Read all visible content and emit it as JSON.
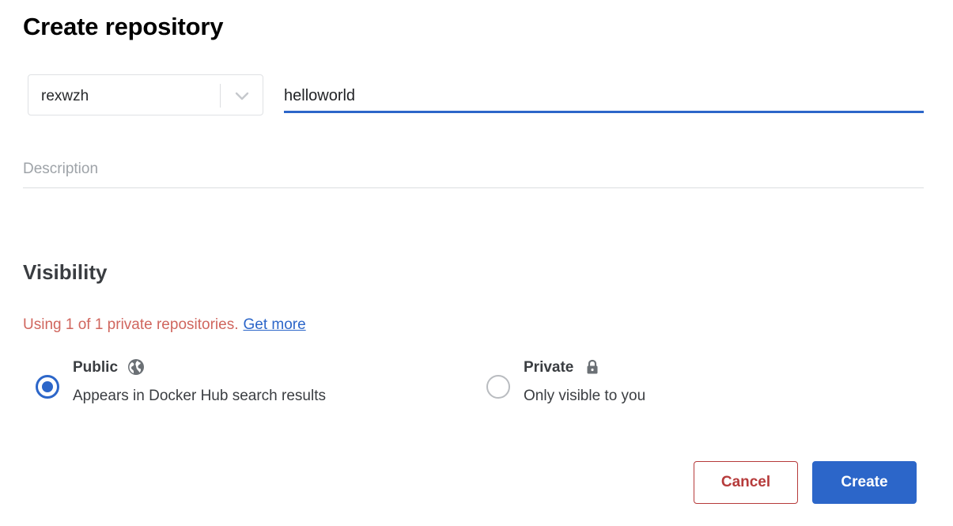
{
  "page": {
    "title": "Create repository"
  },
  "form": {
    "namespace": {
      "selected": "rexwzh",
      "icon": "chevron-down-icon"
    },
    "repo_name": {
      "value": "helloworld"
    },
    "description": {
      "placeholder": "Description",
      "value": ""
    }
  },
  "visibility": {
    "heading": "Visibility",
    "usage_text": "Using 1 of 1 private repositories.",
    "usage_link": "Get more",
    "options": [
      {
        "label": "Public",
        "description": "Appears in Docker Hub search results",
        "icon": "globe-icon",
        "selected": true
      },
      {
        "label": "Private",
        "description": "Only visible to you",
        "icon": "lock-icon",
        "selected": false
      }
    ]
  },
  "actions": {
    "cancel_label": "Cancel",
    "create_label": "Create"
  },
  "colors": {
    "accent": "#2c66c9",
    "warning_text": "#d0665e",
    "cancel": "#b63b3b"
  }
}
